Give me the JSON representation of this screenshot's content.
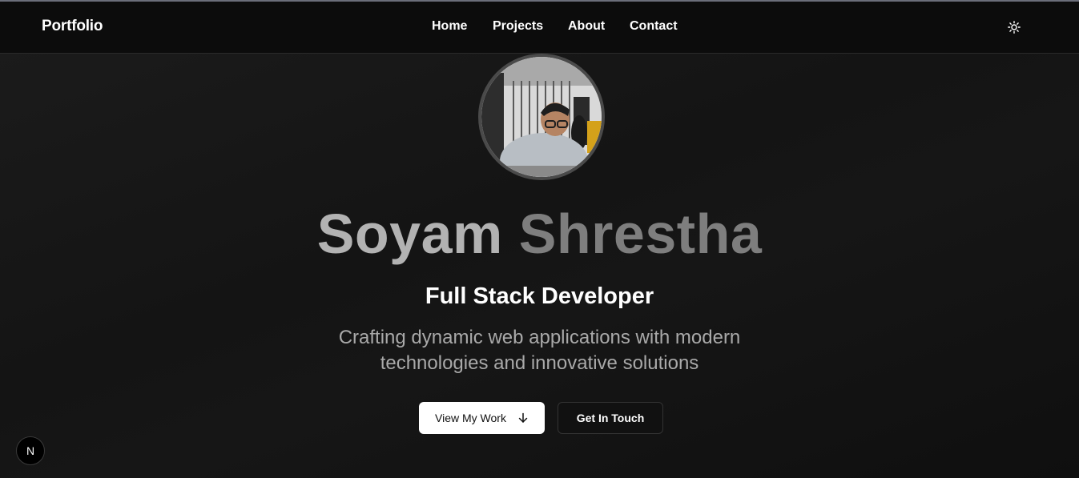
{
  "nav": {
    "brand": "Portfolio",
    "links": [
      "Home",
      "Projects",
      "About",
      "Contact"
    ],
    "theme_icon": "sun-icon"
  },
  "hero": {
    "name_first": "Soyam",
    "name_last": "Shrestha",
    "role": "Full Stack Developer",
    "tagline_line1": "Crafting dynamic web applications with modern",
    "tagline_line2": "technologies and innovative solutions",
    "avatar_image": "profile-photo"
  },
  "buttons": {
    "primary": "View My Work",
    "primary_icon": "arrow-down-icon",
    "secondary": "Get In Touch"
  },
  "badge": {
    "label": "N",
    "icon": "nextjs-dev-indicator"
  },
  "colors": {
    "background": "#111111",
    "navbar": "#0c0c0c",
    "name_first": "#b2b2b2",
    "name_last": "#7e7e7e",
    "primary_button": "#ffffff"
  }
}
